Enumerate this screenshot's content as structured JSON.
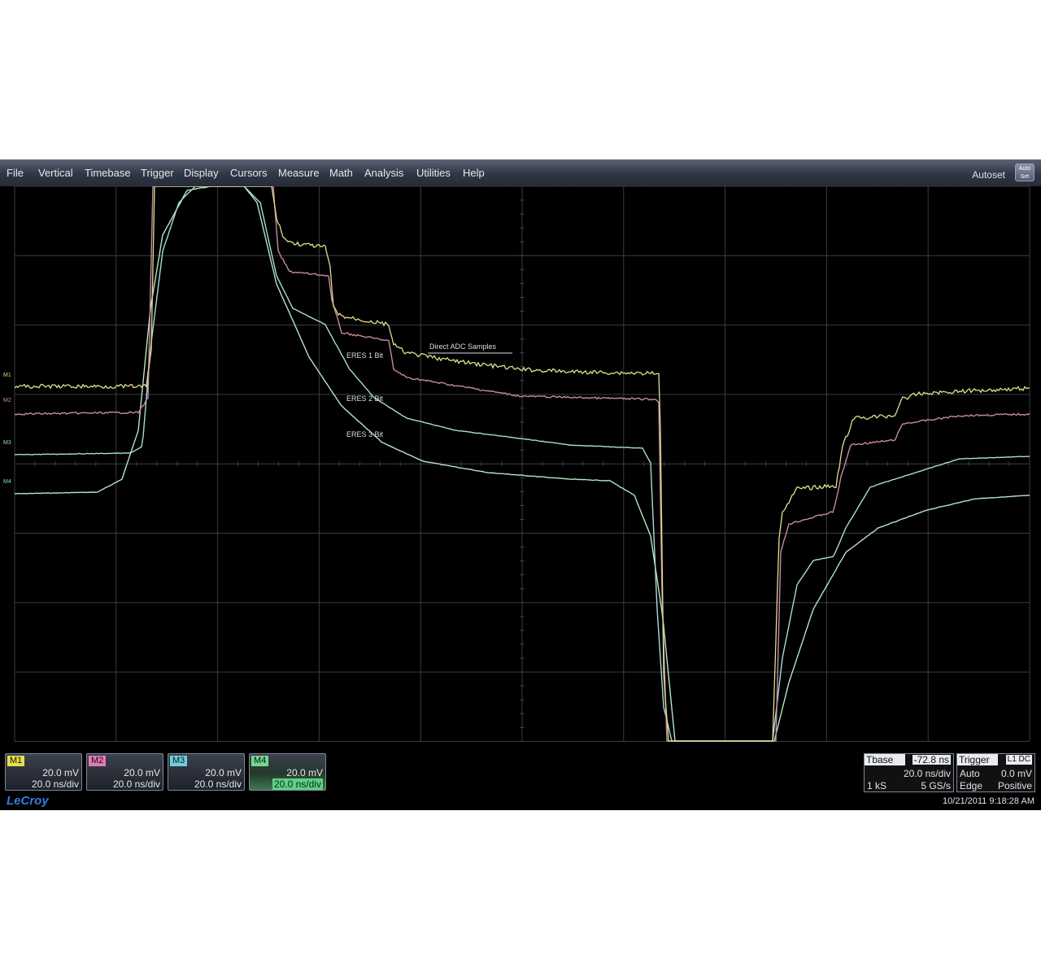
{
  "menu": {
    "items": [
      "File",
      "Vertical",
      "Timebase",
      "Trigger",
      "Display",
      "Cursors",
      "Measure",
      "Math",
      "Analysis",
      "Utilities",
      "Help"
    ],
    "autoset_label": "Autoset",
    "demo_label": "Auto Set"
  },
  "trace_labels": {
    "direct": "Direct ADC Samples",
    "eres1": "ERES 1 Bit",
    "eres2": "ERES 2 Bit",
    "eres3": "ERES 3 Bit"
  },
  "channel_markers": [
    {
      "id": "M1",
      "color": "#d9d97a"
    },
    {
      "id": "M2",
      "color": "#d97fb0"
    },
    {
      "id": "M3",
      "color": "#8fd8e0"
    },
    {
      "id": "M4",
      "color": "#8fe0a0"
    }
  ],
  "channels": [
    {
      "tag": "M1",
      "volts": "20.0 mV",
      "time": "20.0 ns/div",
      "color": "#e6e04c"
    },
    {
      "tag": "M2",
      "volts": "20.0 mV",
      "time": "20.0 ns/div",
      "color": "#e27ab9"
    },
    {
      "tag": "M3",
      "volts": "20.0 mV",
      "time": "20.0 ns/div",
      "color": "#6fd0dc"
    },
    {
      "tag": "M4",
      "volts": "20.0 mV",
      "time": "20.0 ns/div",
      "color": "#72d990"
    }
  ],
  "timebase": {
    "label": "Tbase",
    "delay": "-72.8 ns",
    "rate": "20.0 ns/div",
    "points": "1 kS",
    "sample_rate": "5 GS/s"
  },
  "trigger": {
    "label": "Trigger",
    "chip": "L1 DC",
    "mode": "Auto",
    "level": "0.0 mV",
    "type": "Edge",
    "slope": "Positive"
  },
  "brand": "LeCroy",
  "timestamp": "10/21/2011 9:18:28 AM",
  "colors": {
    "yellow": "#e2e08e",
    "pink": "#c889a2",
    "cyan": "#a6dcd8",
    "green": "#b6e6c0",
    "grid": "#3a3d44"
  }
}
